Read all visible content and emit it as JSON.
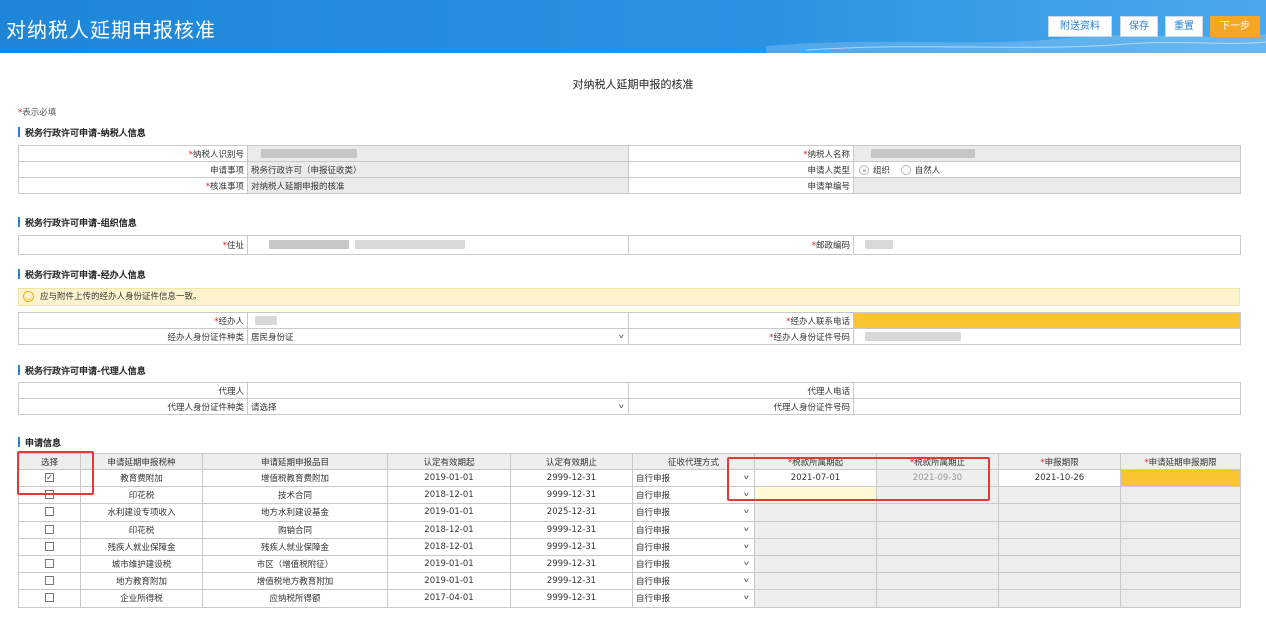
{
  "header": {
    "title": "对纳税人延期申报核准",
    "buttons": {
      "attachment": "附送资料",
      "save": "保存",
      "reset": "重置",
      "next": "下一步"
    }
  },
  "doc_title": "对纳税人延期申报的核准",
  "required_note": {
    "star": "*",
    "text": "表示必填"
  },
  "taxpayer": {
    "section": "税务行政许可申请-纳税人信息",
    "id_label": "纳税人识别号",
    "name_label": "纳税人名称",
    "matter_label": "申请事项",
    "matter_value": "税务行政许可（申报征收类）",
    "applicant_type_label": "申请人类型",
    "applicant_type_options": [
      "组织",
      "自然人"
    ],
    "approval_label": "核准事项",
    "approval_value": "对纳税人延期申报的核准",
    "app_no_label": "申请单编号"
  },
  "organization": {
    "section": "税务行政许可申请-组织信息",
    "address_label": "住址",
    "postcode_label": "邮政编码"
  },
  "handler": {
    "section": "税务行政许可申请-经办人信息",
    "notice": "应与附件上传的经办人身份证件信息一致。",
    "name_label": "经办人",
    "name_partial": "",
    "phone_label": "经办人联系电话",
    "id_type_label": "经办人身份证件种类",
    "id_type_value": "居民身份证",
    "id_no_label": "经办人身份证件号码"
  },
  "agent": {
    "section": "税务行政许可申请-代理人信息",
    "name_label": "代理人",
    "phone_label": "代理人电话",
    "id_type_label": "代理人身份证件种类",
    "id_type_value": "请选择",
    "id_no_label": "代理人身份证件号码"
  },
  "application": {
    "section": "申请信息",
    "headers": [
      "选择",
      "申请延期申报税种",
      "申请延期申报品目",
      "认定有效期起",
      "认定有效期止",
      "征收代理方式",
      "税款所属期起",
      "税款所属期止",
      "申报期限",
      "申请延期申报期限"
    ],
    "rows": [
      {
        "checked": true,
        "tax": "教育费附加",
        "item": "增值税教育费附加",
        "start": "2019-01-01",
        "end": "2999-12-31",
        "method": "自行申报",
        "period_start": "2021-07-01",
        "period_end": "2021-09-30",
        "deadline": "2021-10-26",
        "ext": ""
      },
      {
        "checked": false,
        "tax": "印花税",
        "item": "技术合同",
        "start": "2018-12-01",
        "end": "9999-12-31",
        "method": "自行申报",
        "period_start": "",
        "period_end": "",
        "deadline": "",
        "ext": ""
      },
      {
        "checked": false,
        "tax": "水利建设专项收入",
        "item": "地方水利建设基金",
        "start": "2019-01-01",
        "end": "2025-12-31",
        "method": "自行申报",
        "period_start": "",
        "period_end": "",
        "deadline": "",
        "ext": ""
      },
      {
        "checked": false,
        "tax": "印花税",
        "item": "购销合同",
        "start": "2018-12-01",
        "end": "9999-12-31",
        "method": "自行申报",
        "period_start": "",
        "period_end": "",
        "deadline": "",
        "ext": ""
      },
      {
        "checked": false,
        "tax": "残疾人就业保障金",
        "item": "残疾人就业保障金",
        "start": "2018-12-01",
        "end": "9999-12-31",
        "method": "自行申报",
        "period_start": "",
        "period_end": "",
        "deadline": "",
        "ext": ""
      },
      {
        "checked": false,
        "tax": "城市维护建设税",
        "item": "市区（增值税附征）",
        "start": "2019-01-01",
        "end": "2999-12-31",
        "method": "自行申报",
        "period_start": "",
        "period_end": "",
        "deadline": "",
        "ext": ""
      },
      {
        "checked": false,
        "tax": "地方教育附加",
        "item": "增值税地方教育附加",
        "start": "2019-01-01",
        "end": "2999-12-31",
        "method": "自行申报",
        "period_start": "",
        "period_end": "",
        "deadline": "",
        "ext": ""
      },
      {
        "checked": false,
        "tax": "企业所得税",
        "item": "应纳税所得额",
        "start": "2017-04-01",
        "end": "9999-12-31",
        "method": "自行申报",
        "period_start": "",
        "period_end": "",
        "deadline": "",
        "ext": ""
      }
    ],
    "checkmark": "✓"
  },
  "colors": {
    "header_blue": "#2a93e2",
    "required_yellow": "#fbc531",
    "highlight_red": "#e53935",
    "next_button": "#f5a623"
  }
}
